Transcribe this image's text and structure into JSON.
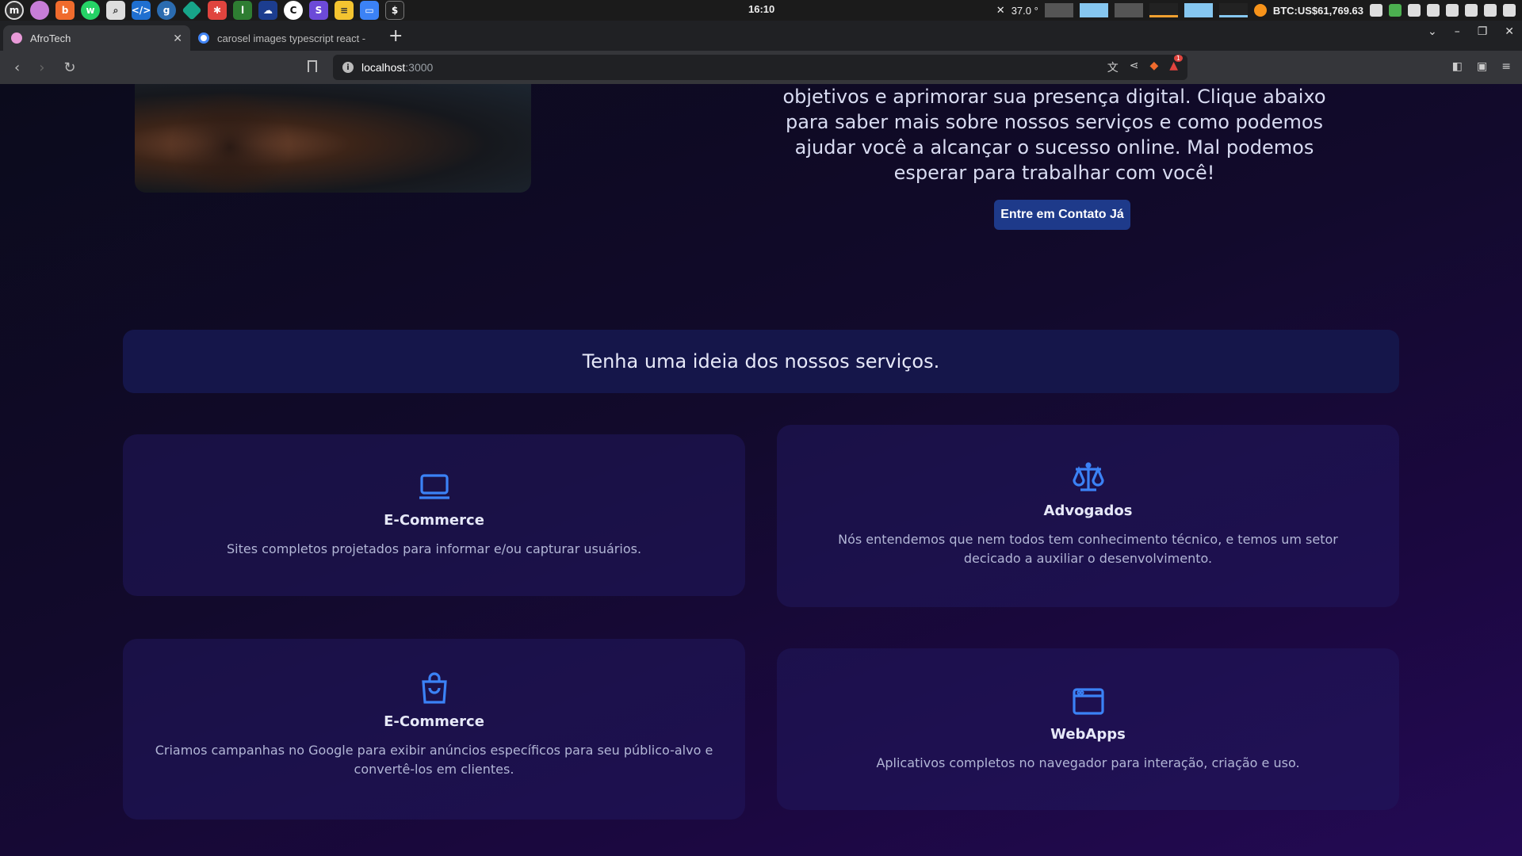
{
  "os": {
    "clock": "16:10",
    "temperature": "37.0 °",
    "btc": "BTC:US$61,769.63",
    "close_glyph": "✕"
  },
  "browser": {
    "tabs": [
      {
        "title": "AfroTech",
        "active": true
      },
      {
        "title": "carosel images typescript react -",
        "active": false
      }
    ],
    "url_host": "localhost",
    "url_port": ":3000",
    "brave_badge": "1"
  },
  "page": {
    "intro_text": "objetivos e aprimorar sua presença digital. Clique abaixo para saber mais sobre nossos serviços e como podemos ajudar você a alcançar o sucesso online. Mal podemos esperar para trabalhar com você!",
    "cta_label": "Entre em Contato Já",
    "services_banner": "Tenha uma ideia dos nossos serviços.",
    "cards": [
      {
        "icon": "laptop-icon",
        "title": "E-Commerce",
        "desc": "Sites completos projetados para informar e/ou capturar usuários."
      },
      {
        "icon": "scale-icon",
        "title": "Advogados",
        "desc": "Nós entendemos que nem todos tem conhecimento técnico, e temos um setor decicado a auxiliar o desenvolvimento."
      },
      {
        "icon": "shopping-bag-icon",
        "title": "E-Commerce",
        "desc": "Criamos campanhas no Google para exibir anúncios específicos para seu público-alvo e convertê-los em clientes."
      },
      {
        "icon": "browser-window-icon",
        "title": "WebApps",
        "desc": "Aplicativos completos no navegador para interação, criação e uso."
      }
    ],
    "accent_color": "#3b82f6",
    "cta_color": "#1e3a8a"
  }
}
